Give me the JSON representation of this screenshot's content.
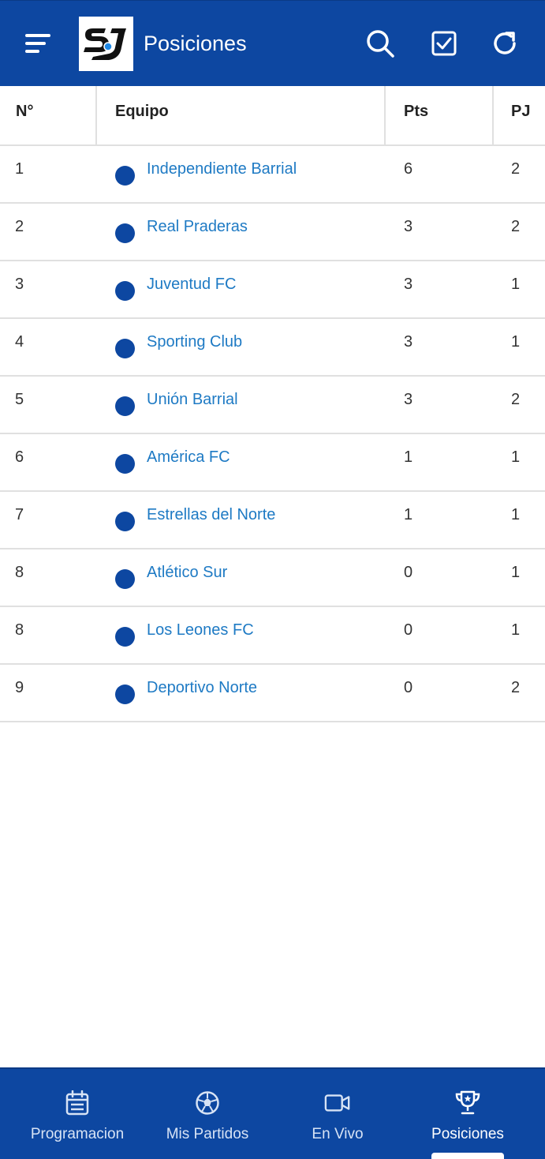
{
  "header": {
    "title": "Posiciones",
    "background_color": "#0d47a1",
    "icons": {
      "menu": "menu-icon",
      "search": "search-icon",
      "check": "checkbox-icon",
      "refresh": "refresh-icon"
    }
  },
  "table": {
    "columns": {
      "pos": "N°",
      "team": "Equipo",
      "pts": "Pts",
      "pj": "PJ"
    },
    "rows": [
      {
        "pos": "1",
        "team": "Independiente Barrial",
        "pts": "6",
        "pj": "2"
      },
      {
        "pos": "2",
        "team": "Real Praderas",
        "pts": "3",
        "pj": "2"
      },
      {
        "pos": "3",
        "team": "Juventud FC",
        "pts": "3",
        "pj": "1"
      },
      {
        "pos": "4",
        "team": "Sporting Club",
        "pts": "3",
        "pj": "1"
      },
      {
        "pos": "5",
        "team": "Unión Barrial",
        "pts": "3",
        "pj": "2"
      },
      {
        "pos": "6",
        "team": "América FC",
        "pts": "1",
        "pj": "1"
      },
      {
        "pos": "7",
        "team": "Estrellas del Norte",
        "pts": "1",
        "pj": "1"
      },
      {
        "pos": "8",
        "team": "Atlético Sur",
        "pts": "0",
        "pj": "1"
      },
      {
        "pos": "8",
        "team": "Los Leones FC",
        "pts": "0",
        "pj": "1"
      },
      {
        "pos": "9",
        "team": "Deportivo Norte",
        "pts": "0",
        "pj": "2"
      }
    ],
    "team_link_color": "#1e7ac4",
    "team_dot_color": "#0d47a1"
  },
  "bottom_nav": {
    "items": [
      {
        "label": "Programacion",
        "icon": "calendar-icon"
      },
      {
        "label": "Mis Partidos",
        "icon": "soccer-ball-icon"
      },
      {
        "label": "En Vivo",
        "icon": "video-camera-icon"
      },
      {
        "label": "Posiciones",
        "icon": "trophy-icon",
        "active": true
      }
    ]
  }
}
